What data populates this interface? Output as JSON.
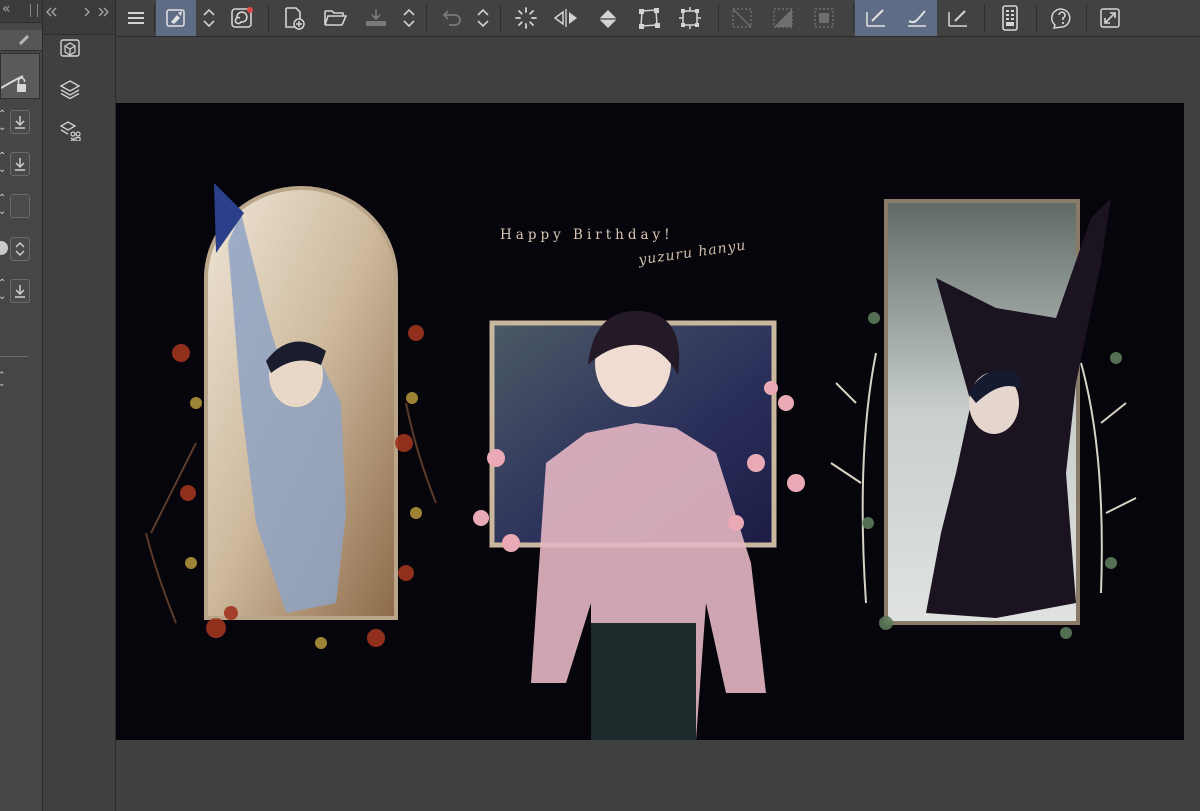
{
  "toolbar": {
    "buttons": [
      {
        "icon": "menu-icon",
        "active": false
      },
      {
        "icon": "select-layer-icon",
        "active": true
      },
      {
        "icon": "spin-icon",
        "active": false
      },
      {
        "icon": "pen-pressure-icon",
        "active": false
      },
      {
        "icon": "new-document-icon",
        "active": false
      },
      {
        "icon": "open-folder-icon",
        "active": false
      },
      {
        "icon": "save-icon",
        "active": false
      },
      {
        "icon": "spin-icon",
        "active": false
      },
      {
        "icon": "undo-icon",
        "active": false
      },
      {
        "icon": "spin-icon",
        "active": false
      },
      {
        "icon": "loading-icon",
        "active": false
      },
      {
        "icon": "flip-horizontal-icon",
        "active": false
      },
      {
        "icon": "fill-bucket-icon",
        "active": false
      },
      {
        "icon": "transform-icon",
        "active": false
      },
      {
        "icon": "crop-icon",
        "active": false
      },
      {
        "icon": "clear-selection-icon",
        "active": false
      },
      {
        "icon": "invert-selection-icon",
        "active": false
      },
      {
        "icon": "selection-border-icon",
        "active": false
      },
      {
        "icon": "ruler-pen-icon",
        "active": true
      },
      {
        "icon": "ruler-brush-icon",
        "active": true
      },
      {
        "icon": "ruler-edit-icon",
        "active": false
      },
      {
        "icon": "smartphone-icon",
        "active": false
      },
      {
        "icon": "help-icon",
        "active": false
      },
      {
        "icon": "fullscreen-icon",
        "active": false
      }
    ]
  },
  "palette_bar": {
    "icons": [
      "material-icon",
      "layers-icon",
      "sub-tool-icon"
    ]
  },
  "colors": {
    "accent": "#5e6c86",
    "artwork_background": "#06050c",
    "title_color": "#d9c7b3"
  },
  "canvas": {
    "title_text": "Happy Birthday!",
    "signature_text": "yuzuru hanyu"
  }
}
